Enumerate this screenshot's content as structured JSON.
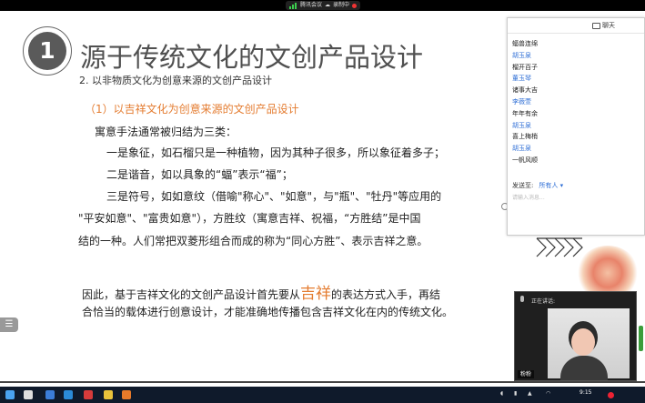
{
  "topbar": {
    "meeting_label": "腾讯会议",
    "recording_label": "录制中",
    "signal_color": "#3ccf4e"
  },
  "slide": {
    "badge_number": "1",
    "title": "源于传统文化的文创产品设计",
    "subtitle": "2. 以非物质文化为创意来源的文创产品设计",
    "section_heading": "（1）以吉祥文化为创意来源的文创产品设计",
    "lines": [
      "寓意手法通常被归结为三类：",
      "一是象征，如石榴只是一种植物，因为其种子很多，所以象征着多子；",
      "二是谐音，如以具象的“蝠”表示“福”；",
      "三是符号，如如意纹（借喻\"称心\"、\"如意\"，与\"瓶\"、\"牡丹\"等应用的",
      "\"平安如意\"、\"富贵如意\"），方胜纹（寓意吉祥、祝福，“方胜结”是中国",
      "结的一种。人们常把双菱形组合而成的称为“同心方胜”、表示吉祥之意。"
    ],
    "conclusion_part1": "因此，基于吉祥文化的文创产品设计首先要从",
    "conclusion_highlight": "吉祥",
    "conclusion_part2": "的表达方式入手，再结",
    "conclusion_line2": "合恰当的载体进行创意设计，才能准确地传播包含吉祥文化在内的传统文化。",
    "accent_color": "#e47c30"
  },
  "chat": {
    "title": "聊天",
    "messages": [
      {
        "text": "蝠兽连绵",
        "is_name": false
      },
      {
        "text": "胡玉泉",
        "is_name": true
      },
      {
        "text": "榴开百子",
        "is_name": false
      },
      {
        "text": "董玉琴",
        "is_name": true
      },
      {
        "text": "诸事大吉",
        "is_name": false
      },
      {
        "text": "李薇萱",
        "is_name": true
      },
      {
        "text": "年年有余",
        "is_name": false
      },
      {
        "text": "胡玉泉",
        "is_name": true
      },
      {
        "text": "喜上梅梢",
        "is_name": false
      },
      {
        "text": "胡玉泉",
        "is_name": true
      },
      {
        "text": "一帆风顺",
        "is_name": false
      }
    ],
    "send_to_label": "发送至:",
    "send_to_target": "所有人",
    "input_placeholder": "请输入消息..."
  },
  "video": {
    "speaking_label": "正在讲话:",
    "participant_name": "粉粉"
  },
  "taskbar": {
    "clock": "9:15"
  }
}
